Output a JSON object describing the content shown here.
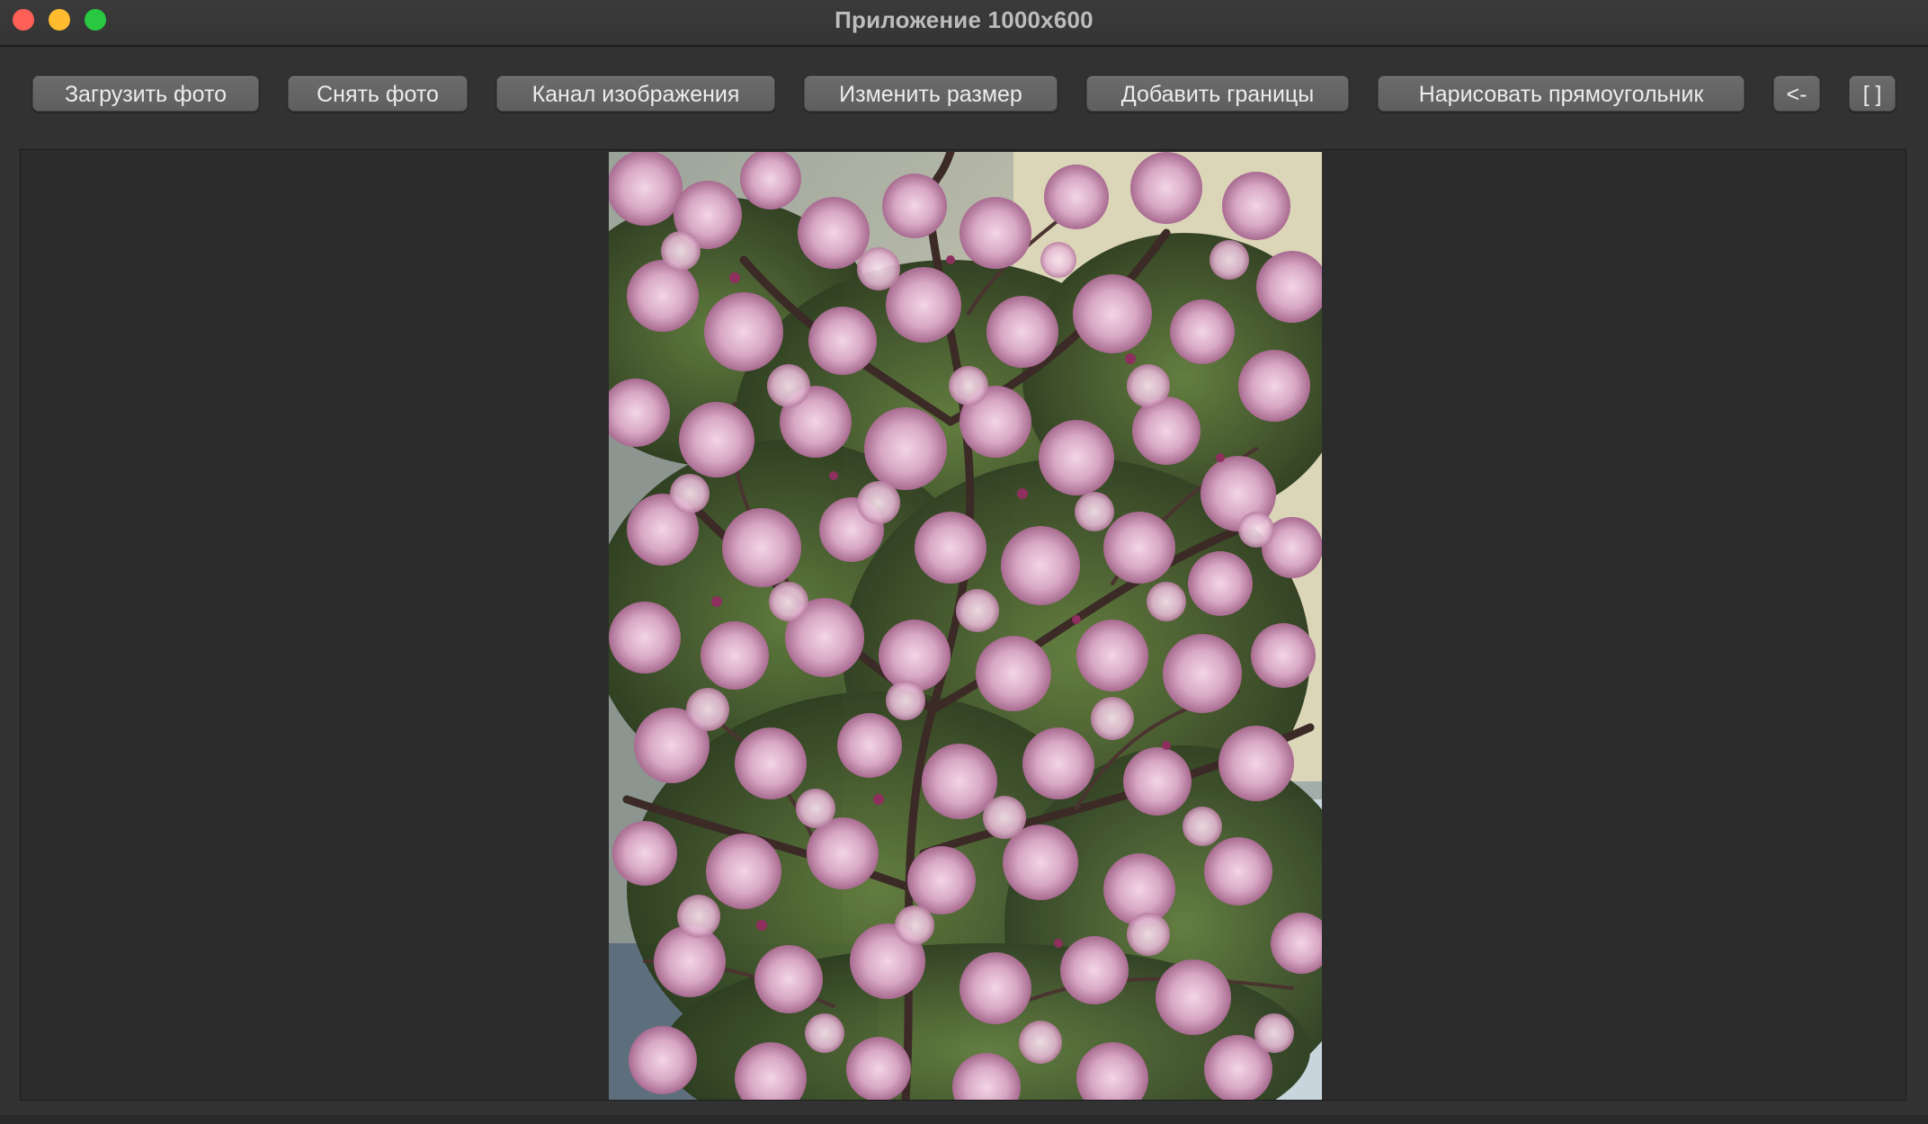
{
  "window": {
    "title": "Приложение 1000x600"
  },
  "toolbar": {
    "buttons": [
      {
        "label": "Загрузить фото"
      },
      {
        "label": "Снять фото"
      },
      {
        "label": "Канал изображения"
      },
      {
        "label": "Изменить размер"
      },
      {
        "label": "Добавить границы"
      },
      {
        "label": "Нарисовать прямоугольник"
      },
      {
        "label": "<-"
      },
      {
        "label": "[ ]"
      }
    ]
  },
  "colors": {
    "window_bg": "#323232",
    "button_bg": "#666666",
    "close": "#fe5f57",
    "minimize": "#febc2e",
    "maximize": "#28c840"
  }
}
